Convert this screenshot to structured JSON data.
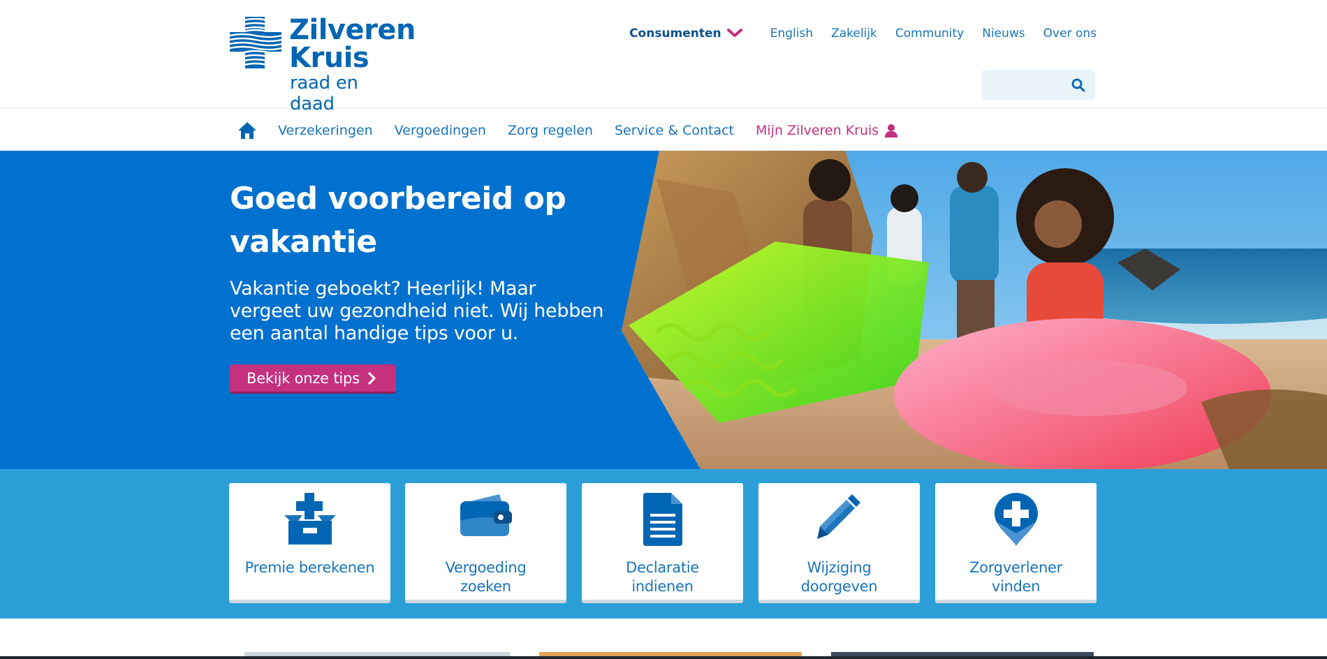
{
  "logo": {
    "line1": "Zilveren",
    "line2": "Kruis",
    "tagline": "raad en daad"
  },
  "topnav": {
    "consumenten": "Consumenten",
    "items": [
      "English",
      "Zakelijk",
      "Community",
      "Nieuws",
      "Over ons"
    ]
  },
  "search": {
    "placeholder": "",
    "value": ""
  },
  "mainnav": {
    "items": [
      "Verzekeringen",
      "Vergoedingen",
      "Zorg regelen",
      "Service & Contact"
    ],
    "mijn": "Mijn Zilveren Kruis"
  },
  "hero": {
    "title": "Goed voorbereid op vakantie",
    "body": "Vakantie geboekt? Heerlijk! Maar vergeet uw gezondheid niet. Wij hebben een aantal handige tips voor u.",
    "cta": "Bekijk onze tips"
  },
  "tiles": [
    {
      "label": "Premie berekenen",
      "icon": "medical-box-icon"
    },
    {
      "label": "Vergoeding zoeken",
      "icon": "wallet-icon"
    },
    {
      "label": "Declaratie indienen",
      "icon": "document-icon"
    },
    {
      "label": "Wijziging doorgeven",
      "icon": "pencil-icon"
    },
    {
      "label": "Zorgverlener vinden",
      "icon": "location-cross-icon"
    }
  ],
  "colors": {
    "brand_blue": "#0066b3",
    "hero_blue": "#0071ce",
    "tiles_band": "#2c9fd9",
    "accent_magenta": "#c5307f"
  }
}
